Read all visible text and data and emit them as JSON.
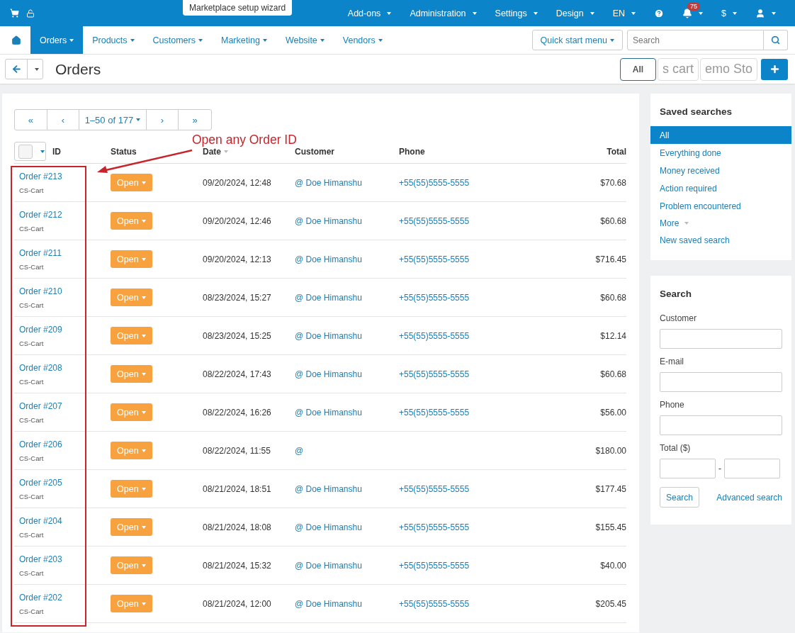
{
  "top_bar": {
    "wizard": "Marketplace setup wizard",
    "menus": [
      {
        "label": "Add-ons"
      },
      {
        "label": "Administration"
      },
      {
        "label": "Settings"
      },
      {
        "label": "Design"
      },
      {
        "label": "EN"
      }
    ],
    "notifications": "75",
    "currency": "$"
  },
  "nav": {
    "items": [
      {
        "label": "Orders",
        "selected": true
      },
      {
        "label": "Products",
        "selected": false
      },
      {
        "label": "Customers",
        "selected": false
      },
      {
        "label": "Marketing",
        "selected": false
      },
      {
        "label": "Website",
        "selected": false
      },
      {
        "label": "Vendors",
        "selected": false
      }
    ],
    "quick_start": "Quick start menu",
    "search_placeholder": "Search"
  },
  "title_bar": {
    "title": "Orders",
    "storefronts": [
      {
        "label": "All",
        "selected": true
      },
      {
        "label": "s cart",
        "selected": false
      },
      {
        "label": "emo Sto",
        "selected": false
      }
    ]
  },
  "pagination": {
    "first": "«",
    "prev": "‹",
    "range": "1–50 of 177",
    "next": "›",
    "last": "»"
  },
  "annotation": {
    "text": "Open any Order ID"
  },
  "table": {
    "select_all_checked": false,
    "columns": [
      "ID",
      "Status",
      "Date",
      "Customer",
      "Phone",
      "Total"
    ],
    "rows": [
      {
        "id": "Order #213",
        "company": "CS-Cart",
        "status": "Open",
        "date": "09/20/2024, 12:48",
        "customer": "@ Doe Himanshu",
        "phone": "+55(55)5555-5555",
        "total": "$70.68"
      },
      {
        "id": "Order #212",
        "company": "CS-Cart",
        "status": "Open",
        "date": "09/20/2024, 12:46",
        "customer": "@ Doe Himanshu",
        "phone": "+55(55)5555-5555",
        "total": "$60.68"
      },
      {
        "id": "Order #211",
        "company": "CS-Cart",
        "status": "Open",
        "date": "09/20/2024, 12:13",
        "customer": "@ Doe Himanshu",
        "phone": "+55(55)5555-5555",
        "total": "$716.45"
      },
      {
        "id": "Order #210",
        "company": "CS-Cart",
        "status": "Open",
        "date": "08/23/2024, 15:27",
        "customer": "@ Doe Himanshu",
        "phone": "+55(55)5555-5555",
        "total": "$60.68"
      },
      {
        "id": "Order #209",
        "company": "CS-Cart",
        "status": "Open",
        "date": "08/23/2024, 15:25",
        "customer": "@ Doe Himanshu",
        "phone": "+55(55)5555-5555",
        "total": "$12.14"
      },
      {
        "id": "Order #208",
        "company": "CS-Cart",
        "status": "Open",
        "date": "08/22/2024, 17:43",
        "customer": "@ Doe Himanshu",
        "phone": "+55(55)5555-5555",
        "total": "$60.68"
      },
      {
        "id": "Order #207",
        "company": "CS-Cart",
        "status": "Open",
        "date": "08/22/2024, 16:26",
        "customer": "@ Doe Himanshu",
        "phone": "+55(55)5555-5555",
        "total": "$56.00"
      },
      {
        "id": "Order #206",
        "company": "CS-Cart",
        "status": "Open",
        "date": "08/22/2024, 11:55",
        "customer": "@",
        "total": "$180.00"
      },
      {
        "id": "Order #205",
        "company": "CS-Cart",
        "status": "Open",
        "date": "08/21/2024, 18:51",
        "customer": "@ Doe Himanshu",
        "phone": "+55(55)5555-5555",
        "total": "$177.45"
      },
      {
        "id": "Order #204",
        "company": "CS-Cart",
        "status": "Open",
        "date": "08/21/2024, 18:08",
        "customer": "@ Doe Himanshu",
        "phone": "+55(55)5555-5555",
        "total": "$155.45"
      },
      {
        "id": "Order #203",
        "company": "CS-Cart",
        "status": "Open",
        "date": "08/21/2024, 15:32",
        "customer": "@ Doe Himanshu",
        "phone": "+55(55)5555-5555",
        "total": "$40.00"
      },
      {
        "id": "Order #202",
        "company": "CS-Cart",
        "status": "Open",
        "date": "08/21/2024, 12:00",
        "customer": "@ Doe Himanshu",
        "phone": "+55(55)5555-5555",
        "total": "$205.45"
      }
    ]
  },
  "saved_searches": {
    "title": "Saved searches",
    "items": [
      {
        "label": "All",
        "selected": true
      },
      {
        "label": "Everything done",
        "selected": false
      },
      {
        "label": "Money received",
        "selected": false
      },
      {
        "label": "Action required",
        "selected": false
      },
      {
        "label": "Problem encountered",
        "selected": false
      }
    ],
    "more": "More",
    "new_search": "New saved search"
  },
  "search": {
    "title": "Search",
    "fields": [
      {
        "label": "Customer",
        "kind": "text"
      },
      {
        "label": "E-mail",
        "kind": "text"
      },
      {
        "label": "Phone",
        "kind": "text"
      },
      {
        "label": "Total ($)",
        "kind": "range",
        "separator": "-"
      }
    ],
    "button": "Search",
    "advanced": "Advanced search"
  }
}
